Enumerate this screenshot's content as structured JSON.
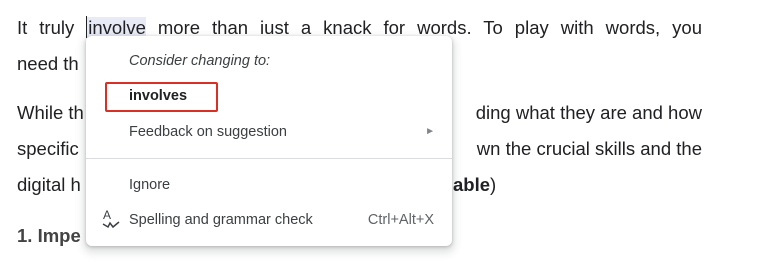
{
  "document": {
    "line1": {
      "before": "It truly ",
      "highlighted": "involve",
      "after": " more than iust a knack for words. To play with words, you"
    },
    "line2": "need th",
    "line3": {
      "left": "While th",
      "right": "ding what they are and how"
    },
    "line4": {
      "left": "specific",
      "right": "wn the crucial skills and the"
    },
    "line5": {
      "left": "digital h",
      "right_bold": "able",
      "right_tail": ")"
    },
    "heading": "1. Impe"
  },
  "context_menu": {
    "header": "Consider changing to:",
    "suggestion": "involves",
    "feedback_label": "Feedback on suggestion",
    "feedback_arrow": "►",
    "ignore_label": "Ignore",
    "spelling_label": "Spelling and grammar check",
    "spelling_shortcut": "Ctrl+Alt+X",
    "spelling_icon": "spellcheck-icon",
    "highlight_color": "#d93025"
  }
}
